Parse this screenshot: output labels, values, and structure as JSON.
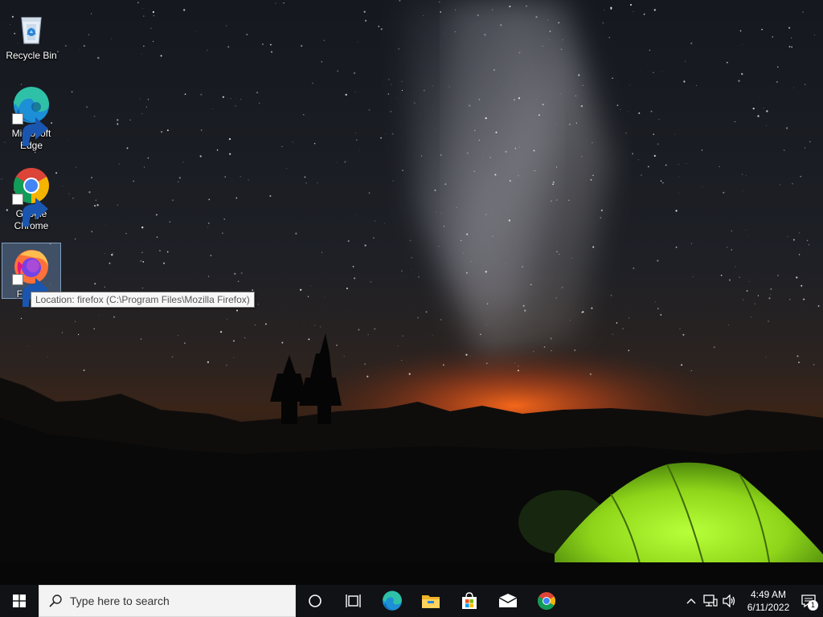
{
  "desktop": {
    "icons": [
      {
        "label": "Recycle Bin",
        "icon": "recycle-bin-icon",
        "shortcut": false
      },
      {
        "label": "Microsoft Edge",
        "icon": "edge-icon",
        "shortcut": true
      },
      {
        "label": "Google Chrome",
        "icon": "chrome-icon",
        "shortcut": true
      },
      {
        "label": "Firefox",
        "icon": "firefox-icon",
        "shortcut": true,
        "selected": true
      }
    ],
    "tooltip": "Location: firefox (C:\\Program Files\\Mozilla Firefox)"
  },
  "taskbar": {
    "start_icon": "windows-logo-icon",
    "search_placeholder": "Type here to search",
    "pinned": [
      {
        "name": "cortana-icon"
      },
      {
        "name": "task-view-icon"
      },
      {
        "name": "edge-icon"
      },
      {
        "name": "file-explorer-icon"
      },
      {
        "name": "microsoft-store-icon"
      },
      {
        "name": "mail-icon"
      },
      {
        "name": "chrome-icon"
      }
    ],
    "tray": {
      "icons": [
        "show-hidden-icons-chevron",
        "network-icon",
        "volume-icon"
      ],
      "time": "4:49 AM",
      "date": "6/11/2022",
      "notification_count": "1"
    }
  },
  "colors": {
    "taskbar_bg": "#101216",
    "search_bg": "#f3f3f3",
    "selection": "#78a0d2",
    "tent_green": "#8fd61a"
  }
}
